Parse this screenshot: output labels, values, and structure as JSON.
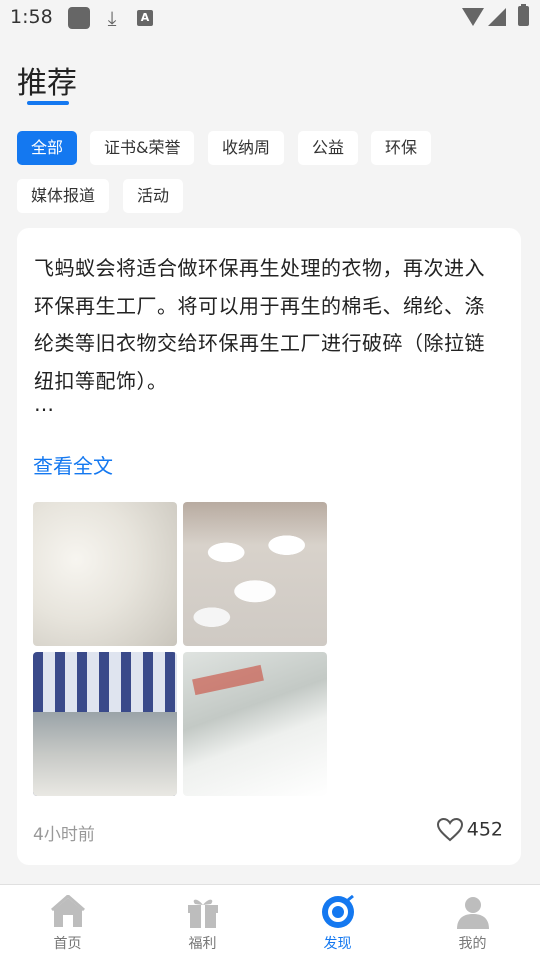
{
  "status_bar": {
    "time": "1:58"
  },
  "page": {
    "title": "推荐"
  },
  "categories": [
    {
      "label": "全部",
      "active": true
    },
    {
      "label": "证书&荣誉",
      "active": false
    },
    {
      "label": "收纳周",
      "active": false
    },
    {
      "label": "公益",
      "active": false
    },
    {
      "label": "环保",
      "active": false
    },
    {
      "label": "媒体报道",
      "active": false
    },
    {
      "label": "活动",
      "active": false
    }
  ],
  "post": {
    "text": "飞蚂蚁会将适合做环保再生处理的衣物，再次进入环保再生工厂。将可以用于再生的棉毛、绵纶、涤纶类等旧衣物交给环保再生工厂进行破碎（除拉链纽扣等配饰）。",
    "ellipsis": "…",
    "read_more": "查看全文",
    "time": "4小时前",
    "likes": "452"
  },
  "tabbar": {
    "items": [
      {
        "label": "首页",
        "icon": "home-icon",
        "active": false
      },
      {
        "label": "福利",
        "icon": "gift-icon",
        "active": false
      },
      {
        "label": "发现",
        "icon": "discover-icon",
        "active": true
      },
      {
        "label": "我的",
        "icon": "profile-icon",
        "active": false
      }
    ]
  },
  "colors": {
    "accent": "#1478f0",
    "background": "#f4f4f4",
    "card": "#ffffff"
  }
}
